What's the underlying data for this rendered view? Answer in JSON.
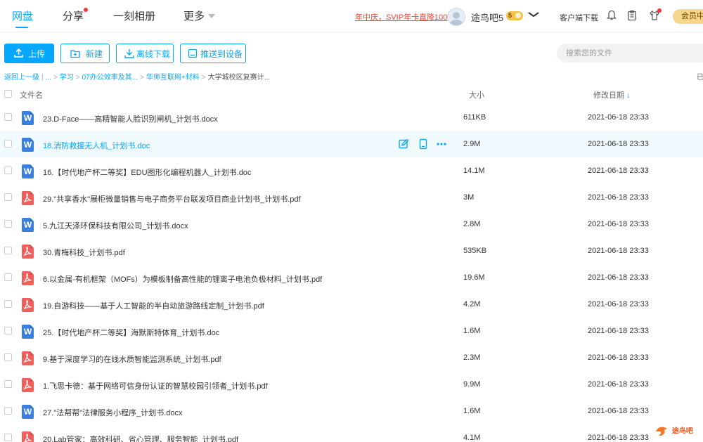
{
  "nav": {
    "tabs": [
      {
        "label": "网盘"
      },
      {
        "label": "分享"
      },
      {
        "label": "一刻相册"
      },
      {
        "label": "更多"
      }
    ],
    "promo": "年中庆，SVIP年卡直降100",
    "username": "途鸟吧5",
    "vip_badge": "5",
    "client_download": "客户端下载",
    "member_button": "会员中",
    "colors": {
      "accent": "#06a7ff",
      "promo": "#e43333",
      "vip": "#f4c04a"
    }
  },
  "toolbar": {
    "upload": "上传",
    "new": "新建",
    "offline_download": "离线下载",
    "push_to_device": "推送到设备",
    "search_placeholder": "搜索您的文件"
  },
  "breadcrumb": {
    "back": "返回上一级",
    "ellipsis": "...",
    "items": [
      "学习",
      "07办公效率及其...",
      "华师互联网+材料"
    ],
    "current": "大学城校区复赛计...",
    "edge_char": "已"
  },
  "table": {
    "headers": {
      "name": "文件名",
      "size": "大小",
      "date": "修改日期"
    },
    "sort_indicator": "↓",
    "rows": [
      {
        "name": "23.D-Face——高精智能人脸识别闸机_计划书.docx",
        "type": "word",
        "icon_letter": "W",
        "size": "611KB",
        "date": "2021-06-18 23:33"
      },
      {
        "name": "18.消防救援无人机_计划书.doc",
        "type": "word",
        "icon_letter": "W",
        "size": "2.9M",
        "date": "2021-06-18 23:33"
      },
      {
        "name": "16.【时代地产杯二等奖】EDU图形化编程机器人_计划书.doc",
        "type": "word",
        "icon_letter": "W",
        "size": "14.1M",
        "date": "2021-06-18 23:33"
      },
      {
        "name": "29.\"共享香水\"展柜微量销售与电子商务平台联发项目商业计划书_计划书.pdf",
        "type": "pdf",
        "icon_letter": "",
        "size": "3M",
        "date": "2021-06-18 23:33"
      },
      {
        "name": "5.九江天泽环保科技有限公司_计划书.docx",
        "type": "word",
        "icon_letter": "W",
        "size": "2.8M",
        "date": "2021-06-18 23:33"
      },
      {
        "name": "30.青梅科技_计划书.pdf",
        "type": "pdf",
        "icon_letter": "",
        "size": "535KB",
        "date": "2021-06-18 23:33"
      },
      {
        "name": "6.以金属-有机框架（MOFs）为模板制备高性能的锂离子电池负极材料_计划书.pdf",
        "type": "pdf",
        "icon_letter": "",
        "size": "19.6M",
        "date": "2021-06-18 23:33"
      },
      {
        "name": "19.自游科技——基于人工智能的半自动旅游路线定制_计划书.pdf",
        "type": "pdf",
        "icon_letter": "",
        "size": "4.2M",
        "date": "2021-06-18 23:33"
      },
      {
        "name": "25.【时代地产杯二等奖】海默斯特体育_计划书.doc",
        "type": "word",
        "icon_letter": "W",
        "size": "1.6M",
        "date": "2021-06-18 23:33"
      },
      {
        "name": "9.基于深度学习的在线水质智能监测系统_计划书.pdf",
        "type": "pdf",
        "icon_letter": "",
        "size": "2.3M",
        "date": "2021-06-18 23:33"
      },
      {
        "name": "1.飞思卡德：基于网络可信身份认证的智慧校园引领者_计划书.pdf",
        "type": "pdf",
        "icon_letter": "",
        "size": "9.9M",
        "date": "2021-06-18 23:33"
      },
      {
        "name": "27.\"法帮帮\"法律服务小程序_计划书.docx",
        "type": "word",
        "icon_letter": "W",
        "size": "1.6M",
        "date": "2021-06-18 23:33"
      },
      {
        "name": "20.Lab管家：高效科研、省心管理、服务智能_计划书.pdf",
        "type": "pdf",
        "icon_letter": "",
        "size": "4.1M",
        "date": "2021-06-18 23:33"
      }
    ],
    "hover_row_index": 1
  },
  "watermark": "途鸟吧"
}
